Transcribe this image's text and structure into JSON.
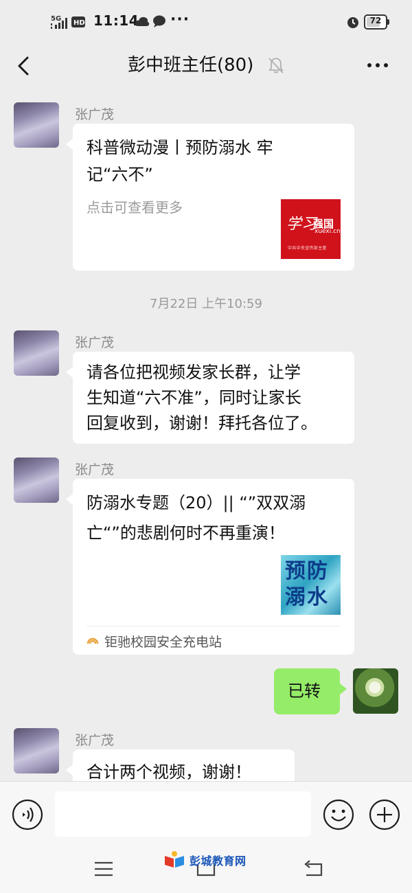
{
  "status_bar": {
    "network": "5G",
    "hd": "HD",
    "time": "11:14",
    "more": "···",
    "battery_level": 72,
    "battery_text": "72"
  },
  "header": {
    "title": "彭中班主任(80)"
  },
  "messages": [
    {
      "type": "card",
      "sender": "张广茂",
      "title_lines": [
        "科普微动漫丨预防溺水 牢",
        "记“六不”"
      ],
      "subtitle": "点击可查看更多",
      "thumb": {
        "big": "学习",
        "brand": "强国",
        "url": "xuexi.cn",
        "small": "中共中央宣传部主管"
      }
    },
    {
      "type": "timestamp",
      "text": "7月22日 上午10:59"
    },
    {
      "type": "text",
      "sender": "张广茂",
      "lines": [
        "请各位把视频发家长群，让学",
        "生知道“六不准”，同时让家长",
        "回复收到，谢谢！拜托各位了。"
      ]
    },
    {
      "type": "card",
      "sender": "张广茂",
      "title_lines": [
        "防溺水专题（20）|| “”双双溺",
        "亡“”的悲剧何时不再重演！"
      ],
      "thumb": {
        "line1": "预防",
        "line2": "溺水"
      },
      "source": "钜驰校园安全充电站"
    },
    {
      "type": "text",
      "self": true,
      "text": "已转"
    },
    {
      "type": "text",
      "sender": "张广茂",
      "text": "合计两个视频，谢谢！"
    }
  ],
  "input": {
    "value": "",
    "placeholder": ""
  },
  "watermark": {
    "text": "彭城教育网"
  },
  "colors": {
    "background": "#ededed",
    "self_bubble": "#95ec69",
    "other_bubble": "#ffffff",
    "card_thumb_red": "#d0121b"
  }
}
